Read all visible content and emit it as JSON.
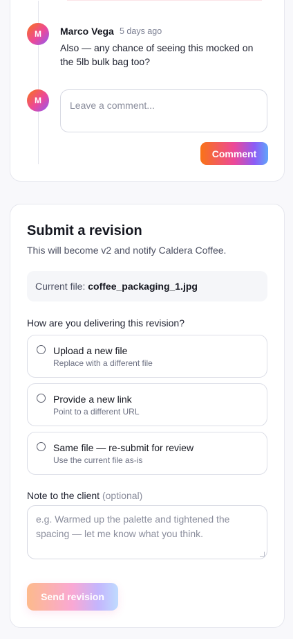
{
  "comments": {
    "entry": {
      "avatar_initial": "M",
      "author": "Marco Vega",
      "time": "5 days ago",
      "text": "Also — any chance of seeing this mocked on the 5lb bulk bag too?"
    },
    "composer": {
      "avatar_initial": "M",
      "placeholder": "Leave a comment...",
      "button_label": "Comment"
    }
  },
  "revision": {
    "title": "Submit a revision",
    "subtitle": "This will become v2 and notify Caldera Coffee.",
    "current_file_label": "Current file:",
    "current_file_name": "coffee_packaging_1.jpg",
    "question": "How are you delivering this revision?",
    "options": [
      {
        "label": "Upload a new file",
        "description": "Replace with a different file"
      },
      {
        "label": "Provide a new link",
        "description": "Point to a different URL"
      },
      {
        "label": "Same file — re-submit for review",
        "description": "Use the current file as-is"
      }
    ],
    "note_label": "Note to the client",
    "note_optional": "(optional)",
    "note_placeholder": "e.g. Warmed up the palette and tightened the spacing — let me know what you think.",
    "send_label": "Send revision"
  },
  "colors": {
    "accent_gradient": [
      "#f97316",
      "#ec4899",
      "#8b5cf6",
      "#60a5fa"
    ]
  },
  "icons": {
    "radio": "radio-unchecked-icon"
  }
}
